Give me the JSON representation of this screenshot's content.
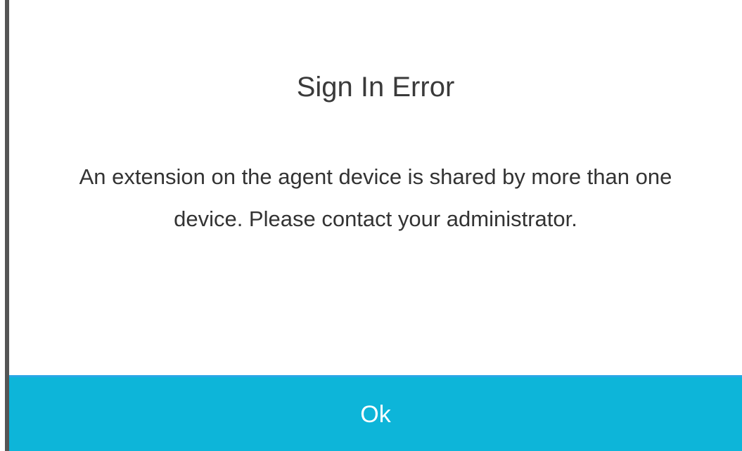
{
  "dialog": {
    "title": "Sign In Error",
    "message": "An extension on the agent device is shared by more than one device. Please contact your administrator.",
    "ok_label": "Ok"
  },
  "colors": {
    "button_background": "#0db5d9",
    "button_text": "#ffffff",
    "title_text": "#3a3a3a",
    "edge": "#555555"
  }
}
